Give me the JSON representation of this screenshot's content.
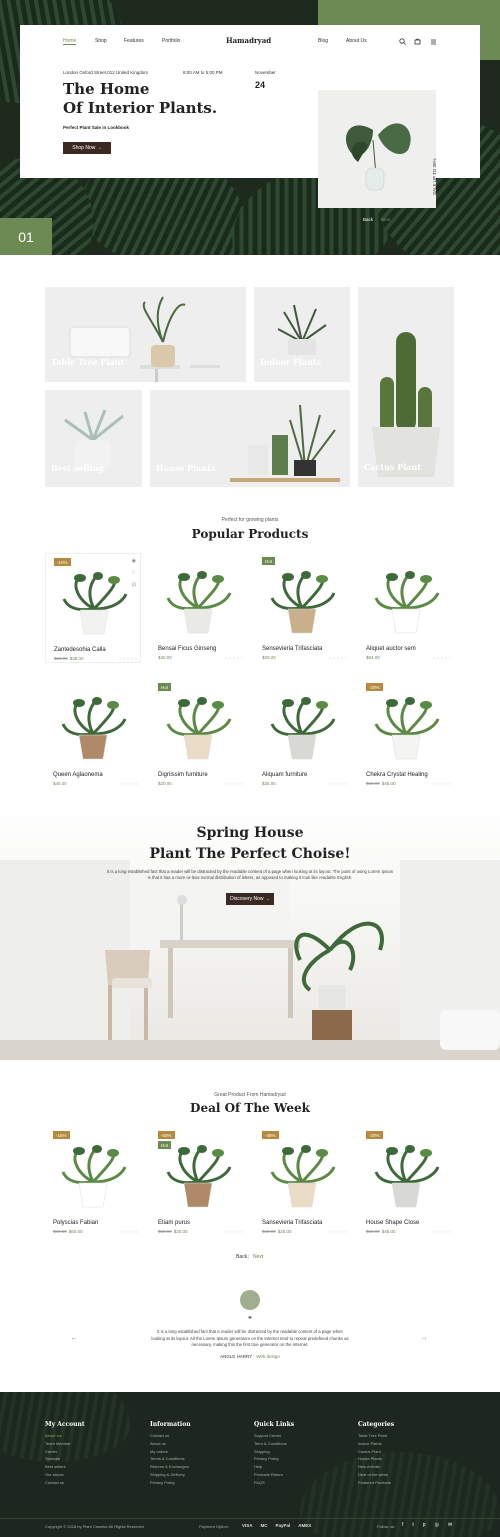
{
  "nav": {
    "links": [
      "Home",
      "Shop",
      "Features",
      "Portfolio",
      "Blog",
      "About Us"
    ],
    "logo": "Hamadryad"
  },
  "hero": {
    "address": "London Oxford Street,012 United Kingdom",
    "hours": "8:00 AM to 5:00 PM",
    "month": "November",
    "day": "24",
    "title_line1": "The Home",
    "title_line2": "Of Interior Plants.",
    "subtitle": "Perfect Plant Sale in Lookbook",
    "cta": "Shop Now",
    "side_text": "SALE UP TO 35%",
    "slide_number": "01",
    "back": "Back",
    "next": "Next"
  },
  "categories": [
    {
      "title": "Table Tree Plant",
      "count": "(50 Items)"
    },
    {
      "title": "Indoor Plants",
      "count": "(75 Items)"
    },
    {
      "title": "Cactus Plant",
      "count": "(40 Items)"
    },
    {
      "title": "Best selling",
      "count": "(55 Items)"
    },
    {
      "title": "House Plants",
      "count": "(50 Items)"
    }
  ],
  "popular": {
    "subtitle": "Perfect for growing plants",
    "title": "Popular Products",
    "products": [
      {
        "name": "Zantedesohia Calla",
        "old": "$50.00",
        "price": "$38.00",
        "badge": "-10%"
      },
      {
        "name": "Bensai Ficus Ginseng",
        "old": "",
        "price": "$40.00",
        "badge": ""
      },
      {
        "name": "Sensevieria Trifasciata",
        "old": "",
        "price": "$20.00",
        "badge": "Hot"
      },
      {
        "name": "Aliquet auctor sem",
        "old": "",
        "price": "$84.00",
        "badge": ""
      },
      {
        "name": "Queen Aglaonema",
        "old": "",
        "price": "$40.00",
        "badge": ""
      },
      {
        "name": "Dignissim furniture",
        "old": "",
        "price": "$20.00",
        "badge": "Hot"
      },
      {
        "name": "Aliquam furniture",
        "old": "",
        "price": "$35.00",
        "badge": ""
      },
      {
        "name": "Chekra Crystal Healing",
        "old": "$55.00",
        "price": "$45.00",
        "badge": "-20%"
      }
    ],
    "stars": "☆☆☆☆☆"
  },
  "spring": {
    "title_line1": "Spring House",
    "title_line2": "Plant The Perfect Choise!",
    "text": "It is a long established fact that a reader will be distracted by the readable content of a page when looking at its layout. The point of using Lorem Ipsum is that it has a more-or-less normal distribution of letters, as opposed to making it look like readable English.",
    "cta": "Discovery Now"
  },
  "deal": {
    "subtitle": "Great Product From Hamadryad",
    "title": "Deal Of The Week",
    "products": [
      {
        "name": "Polyscias Fabian",
        "old": "$80.00",
        "price": "$60.00",
        "badge": "-15%",
        "badge2": ""
      },
      {
        "name": "Etiam purus",
        "old": "$50.00",
        "price": "$30.00",
        "badge": "-50%",
        "badge2": "Hot"
      },
      {
        "name": "Sansevieria Trifasciata",
        "old": "$40.00",
        "price": "$25.00",
        "badge": "-45%",
        "badge2": ""
      },
      {
        "name": "House Shape Close",
        "old": "$55.00",
        "price": "$45.00",
        "badge": "-20%",
        "badge2": ""
      }
    ],
    "back": "Back",
    "next": "Next"
  },
  "testimonial": {
    "quote_mark": "❝",
    "text": "It is a long established fact that a reader will be distracted by the readable content of a page when looking at its layout. All the Lorem Ipsum generators on the Internet tend to repeat predefined chunks as necessary, making this the first true generator on the Internet.",
    "author": "ANGLE HARRY",
    "role": "Web design"
  },
  "footer": {
    "columns": [
      {
        "title": "My Account",
        "items": [
          "About Us",
          "Team Member",
          "Career",
          "Specials",
          "Best sellers",
          "Our stores",
          "Contact us"
        ]
      },
      {
        "title": "Information",
        "items": [
          "Contact us",
          "About us",
          "My orders",
          "Terms & Conditions",
          "Returns & Exchanges",
          "Shipping & Delivery",
          "Privacy Policy"
        ]
      },
      {
        "title": "Quick Links",
        "items": [
          "Support Center",
          "Term & Conditions",
          "Shipping",
          "Privacy Policy",
          "Help",
          "Products Return",
          "FAQS"
        ]
      },
      {
        "title": "Categories",
        "items": [
          "Table Tree Plant",
          "Indoor Plants",
          "Cactus Plant",
          "House Plants",
          "New Arrivals",
          "Deal of the week",
          "Featured Products"
        ]
      }
    ],
    "copyright": "Copyright © 2018 by Plant Creative All Rights Reserved",
    "payment_label": "Payment Option:",
    "payments": [
      "VISA",
      "MC",
      "PayPal",
      "AMEX"
    ],
    "follow": "Follow us:"
  },
  "colors": {
    "accent": "#6e8a53",
    "dark": "#3a2a23",
    "sale": "#b58a3c",
    "footer": "#1e271f"
  }
}
